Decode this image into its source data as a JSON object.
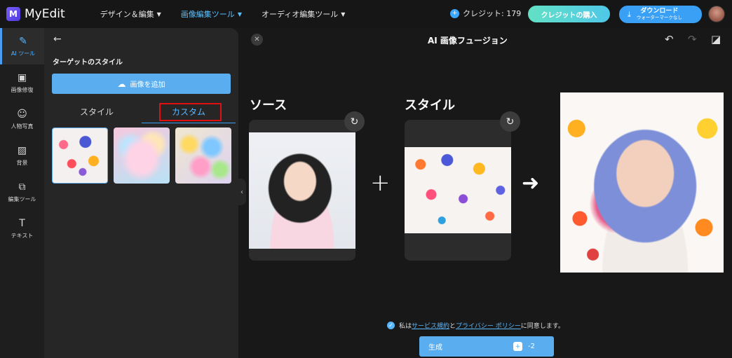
{
  "app": {
    "name": "MyEdit",
    "logo_letter": "M"
  },
  "nav": {
    "items": [
      {
        "label": "デザイン＆編集"
      },
      {
        "label": "画像編集ツール"
      },
      {
        "label": "オーディオ編集ツール"
      }
    ]
  },
  "credits": {
    "label": "クレジット: 179"
  },
  "buy_label": "クレジットの購入",
  "download": {
    "label": "ダウンロード",
    "sublabel": "ウォーターマークなし"
  },
  "rail": [
    {
      "label": "AI ツール",
      "icon": "magic-wand-icon"
    },
    {
      "label": "画像修復",
      "icon": "image-icon"
    },
    {
      "label": "人物写真",
      "icon": "portrait-icon"
    },
    {
      "label": "背景",
      "icon": "background-icon"
    },
    {
      "label": "編集ツール",
      "icon": "layers-icon"
    },
    {
      "label": "テキスト",
      "icon": "text-icon"
    }
  ],
  "panel": {
    "title": "ターゲットのスタイル",
    "add_image": "画像を追加",
    "tabs": {
      "style": "スタイル",
      "custom": "カスタム"
    }
  },
  "canvas": {
    "title": "AI 画像フュージョン",
    "source_label": "ソース",
    "style_label": "スタイル"
  },
  "agreement": {
    "prefix": "私は",
    "terms": "サービス規約",
    "and": "と",
    "privacy": "プライバシー ポリシー",
    "suffix": "に同意します。"
  },
  "generate": {
    "label": "生成",
    "cost": "-2"
  },
  "colors": {
    "accent": "#5aaef0",
    "highlight": "#e01010",
    "buy_gradient_start": "#62e1c5"
  }
}
